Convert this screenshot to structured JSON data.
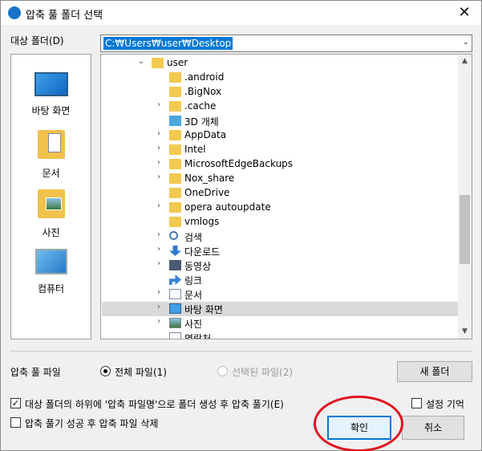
{
  "window": {
    "title": "압축 풀 폴더 선택",
    "close_glyph": "✕"
  },
  "target_folder": {
    "label": "대상 폴더(D)",
    "path": "C:₩Users₩user₩Desktop"
  },
  "places": [
    {
      "label": "바탕 화면",
      "icon": "desktop-icon"
    },
    {
      "label": "문서",
      "icon": "documents-icon"
    },
    {
      "label": "사진",
      "icon": "pictures-icon"
    },
    {
      "label": "컴퓨터",
      "icon": "computer-icon"
    }
  ],
  "tree": {
    "rows": [
      {
        "label": "user",
        "chevron": "⌄",
        "icon": "folder"
      },
      {
        "label": ".android",
        "chevron": "",
        "icon": "folder"
      },
      {
        "label": ".BigNox",
        "chevron": "",
        "icon": "folder"
      },
      {
        "label": ".cache",
        "chevron": "›",
        "icon": "folder"
      },
      {
        "label": "3D 개체",
        "chevron": "",
        "icon": "3d-objects"
      },
      {
        "label": "AppData",
        "chevron": "›",
        "icon": "folder"
      },
      {
        "label": "Intel",
        "chevron": "›",
        "icon": "folder"
      },
      {
        "label": "MicrosoftEdgeBackups",
        "chevron": "›",
        "icon": "folder"
      },
      {
        "label": "Nox_share",
        "chevron": "›",
        "icon": "folder"
      },
      {
        "label": "OneDrive",
        "chevron": "",
        "icon": "folder"
      },
      {
        "label": "opera autoupdate",
        "chevron": "›",
        "icon": "folder"
      },
      {
        "label": "vmlogs",
        "chevron": "",
        "icon": "folder"
      },
      {
        "label": "검색",
        "chevron": "›",
        "icon": "search"
      },
      {
        "label": "다운로드",
        "chevron": "›",
        "icon": "downloads"
      },
      {
        "label": "동영상",
        "chevron": "›",
        "icon": "videos"
      },
      {
        "label": "링크",
        "chevron": "",
        "icon": "links"
      },
      {
        "label": "문서",
        "chevron": "›",
        "icon": "documents"
      },
      {
        "label": "바탕 화면",
        "chevron": "›",
        "icon": "desktop",
        "selected": true
      },
      {
        "label": "사진",
        "chevron": "›",
        "icon": "pictures"
      },
      {
        "label": "연락처",
        "chevron": "",
        "icon": "contacts"
      }
    ]
  },
  "options": {
    "files_label": "압축 풀 파일",
    "radio_all": "전체 파일(1)",
    "radio_selected": "선택된 파일(2)",
    "new_folder_button": "새 폴더",
    "checkbox_create_subfolder": "대상 폴더의 하위에 '압축 파일명'으로 폴더 생성 후 압축 풀기(E)",
    "checkbox_create_subfolder_checked": true,
    "checkbox_remember": "설정 기억",
    "checkbox_remember_checked": false,
    "checkbox_delete_after": "압축 풀기 성공 후 압축 파일 삭제",
    "checkbox_delete_after_checked": false
  },
  "buttons": {
    "ok": "확인",
    "cancel": "취소"
  },
  "colors": {
    "selection": "#0078d7",
    "annotation": "#e0141e"
  }
}
